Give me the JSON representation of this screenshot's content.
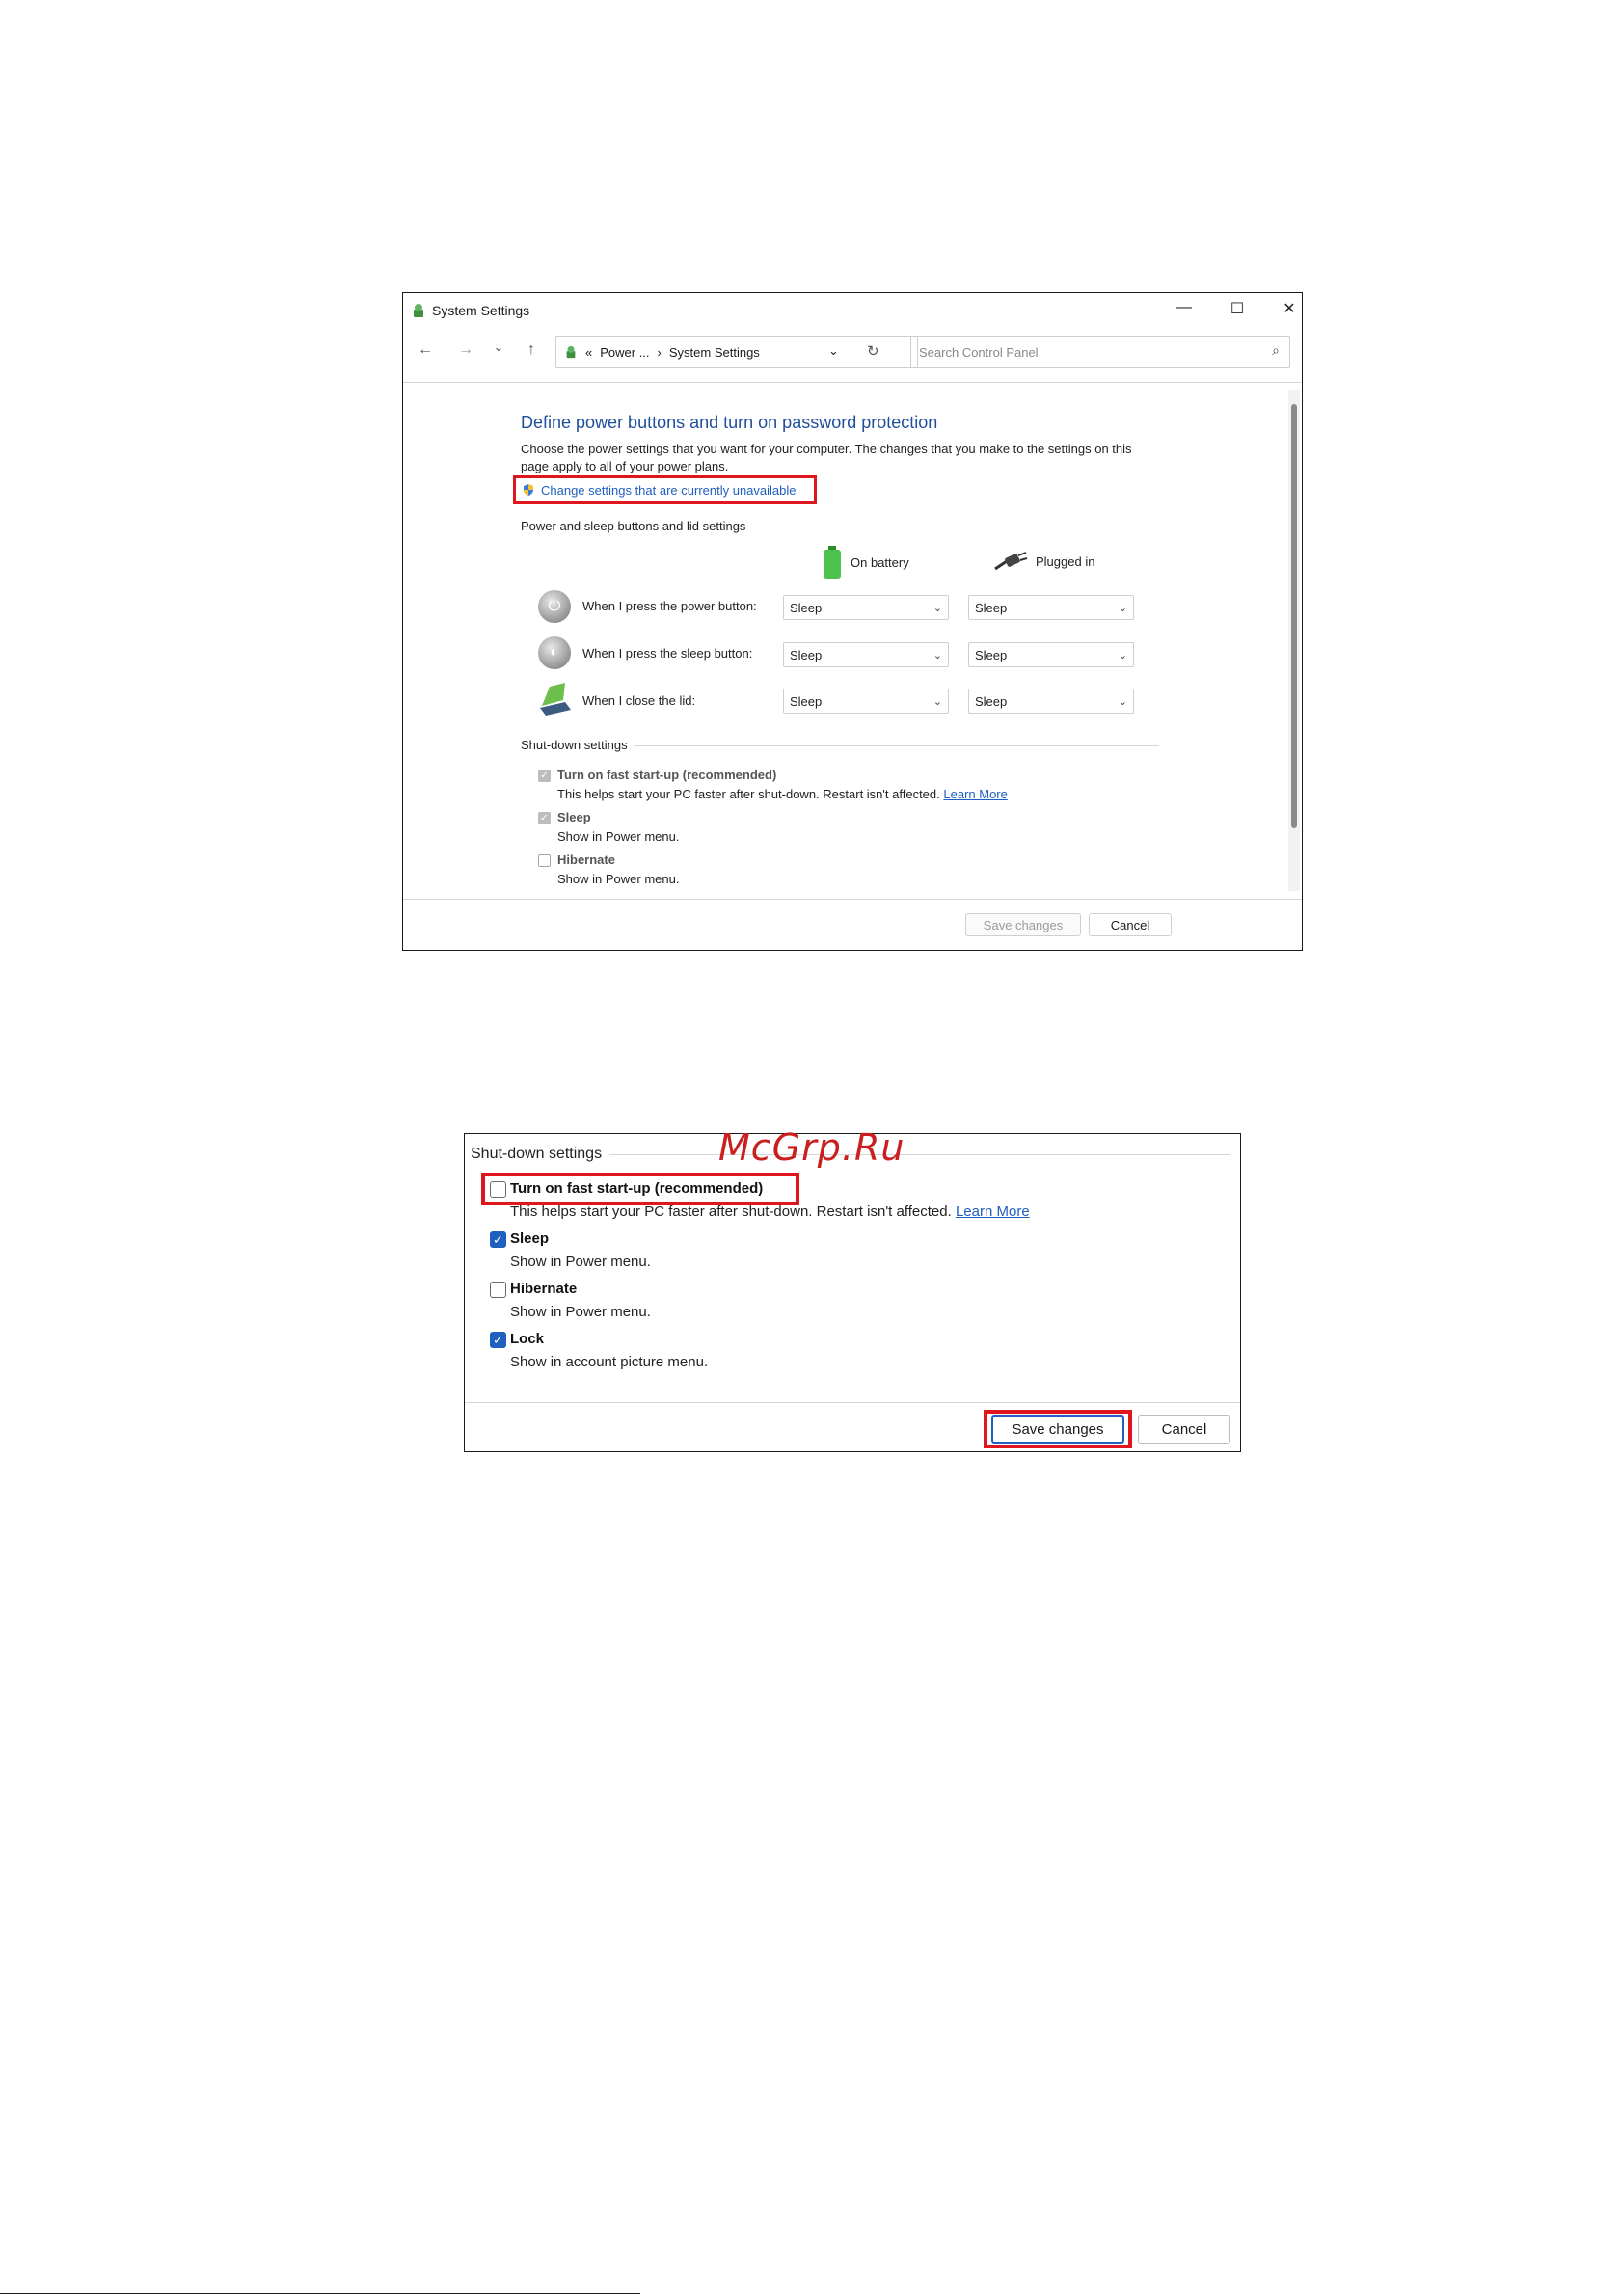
{
  "window1": {
    "title": "System Settings",
    "controls": {
      "minimize": "—",
      "maximize": "☐",
      "close": "✕"
    },
    "nav": {
      "back": "←",
      "forward": "→",
      "recent": "⌄",
      "up": "↑"
    },
    "address": {
      "prefix": "«",
      "crumb1": "Power ...",
      "sep": "›",
      "crumb2": "System Settings"
    },
    "search_placeholder": "Search Control Panel",
    "heading": "Define power buttons and turn on password protection",
    "description": "Choose the power settings that you want for your computer. The changes that you make to the settings on this page apply to all of your power plans.",
    "change_link": "Change settings that are currently unavailable",
    "section_buttons": "Power and sleep buttons and lid settings",
    "col_battery": "On battery",
    "col_plugged": "Plugged in",
    "rows": [
      {
        "label": "When I press the power button:",
        "battery": "Sleep",
        "plugged": "Sleep"
      },
      {
        "label": "When I press the sleep button:",
        "battery": "Sleep",
        "plugged": "Sleep"
      },
      {
        "label": "When I close the lid:",
        "battery": "Sleep",
        "plugged": "Sleep"
      }
    ],
    "section_shutdown": "Shut-down settings",
    "shutdown": [
      {
        "label": "Turn on fast start-up (recommended)",
        "sub": "This helps start your PC faster after shut-down. Restart isn't affected.",
        "link": "Learn More",
        "checked": true
      },
      {
        "label": "Sleep",
        "sub": "Show in Power menu.",
        "checked": true
      },
      {
        "label": "Hibernate",
        "sub": "Show in Power menu.",
        "checked": false
      }
    ],
    "save": "Save changes",
    "cancel": "Cancel"
  },
  "window2": {
    "section_shutdown": "Shut-down settings",
    "shutdown": [
      {
        "label": "Turn on fast start-up (recommended)",
        "sub": "This helps start your PC faster after shut-down. Restart isn't affected.",
        "link": "Learn More",
        "checked": false
      },
      {
        "label": "Sleep",
        "sub": "Show in Power menu.",
        "checked": true
      },
      {
        "label": "Hibernate",
        "sub": "Show in Power menu.",
        "checked": false
      },
      {
        "label": "Lock",
        "sub": "Show in account picture menu.",
        "checked": true
      }
    ],
    "save": "Save changes",
    "cancel": "Cancel"
  },
  "watermark": "McGrp.Ru",
  "colors": {
    "accent": "#1f5fbf",
    "highlight": "#e0161f",
    "heading": "#1f4e9c"
  }
}
